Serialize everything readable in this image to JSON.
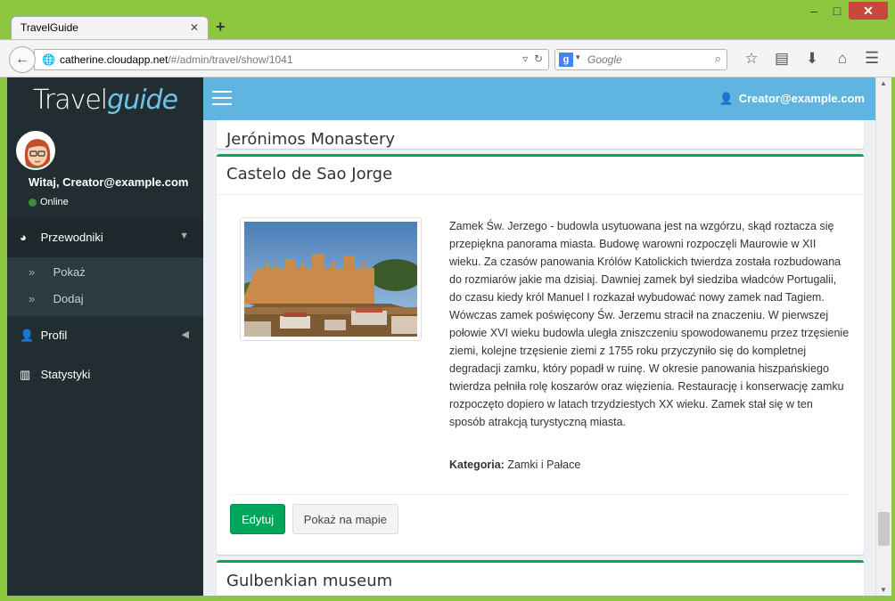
{
  "browser": {
    "tab_title": "TravelGuide",
    "tab_close": "✕",
    "new_tab": "+",
    "url_host": "catherine.cloudapp.net",
    "url_path": "/#/admin/travel/show/1041",
    "search_placeholder": "Google",
    "window_minimize": "‒",
    "window_maximize": "□",
    "window_close": "✕"
  },
  "app": {
    "logo_part1": "Travel",
    "logo_part2": "guide",
    "greeting": "Witaj, Creator@example.com",
    "status": "Online",
    "top_user": "Creator@example.com"
  },
  "sidebar": {
    "guides": "Przewodniki",
    "guides_sub": [
      "Pokaż",
      "Dodaj"
    ],
    "profile": "Profil",
    "stats": "Statystyki"
  },
  "places": {
    "prev_title": "Jerónimos Monastery",
    "current_title": "Castelo de Sao Jorge",
    "description": "Zamek Św. Jerzego - budowla usytuowana jest na wzgórzu, skąd roztacza się przepiękna panorama miasta. Budowę warowni rozpoczęli Maurowie w XII wieku. Za czasów panowania Królów Katolickich twierdza została rozbudowana do rozmiarów jakie ma dzisiaj. Dawniej zamek był siedziba władców Portugalii, do czasu kiedy król Manuel I rozkazał wybudować nowy zamek nad Tagiem. Wówczas zamek poświęcony Św. Jerzemu stracił na znaczeniu. W pierwszej połowie XVI wieku budowla uległa zniszczeniu spowodowanemu przez trzęsienie ziemi, kolejne trzęsienie ziemi z 1755 roku przyczyniło się do kompletnej degradacji zamku, który popadł w ruinę. W okresie panowania hiszpańskiego twierdza pełniła rolę koszarów oraz więzienia. Restaurację i konserwację zamku rozpoczęto dopiero w latach trzydziestych XX wieku. Zamek stał się w ten sposób atrakcją turystyczną miasta.",
    "category_label": "Kategoria:",
    "category_value": "Zamki i Pałace",
    "edit_button": "Edytuj",
    "map_button": "Pokaż na mapie",
    "next_title": "Gulbenkian museum"
  },
  "colors": {
    "accent": "#00a65a",
    "topbar": "#5fb5df",
    "sidebar": "#222d32"
  }
}
